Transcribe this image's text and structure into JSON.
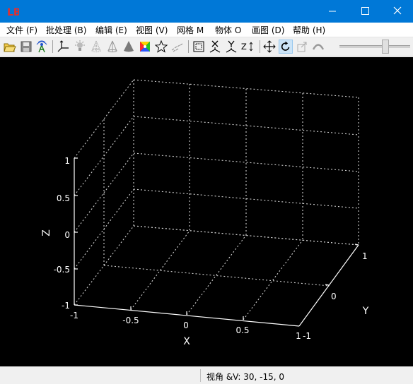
{
  "window": {
    "app_icon_text": "LB"
  },
  "menu": [
    {
      "label": "文件 (F)"
    },
    {
      "label": "批处理 (B)"
    },
    {
      "label": "编辑 (E)"
    },
    {
      "label": "视图 (V)"
    },
    {
      "label": "网格 M"
    },
    {
      "label": "物体 O"
    },
    {
      "label": "画图 (D)"
    },
    {
      "label": "帮助 (H)"
    }
  ],
  "toolbar": {
    "tools": [
      "open-icon",
      "save-icon",
      "antenna-icon",
      "axes-icon",
      "light-icon",
      "cone-wire-icon",
      "cone-mesh-icon",
      "cone-solid-icon",
      "color-cube-icon",
      "star-icon",
      "points-icon",
      "box-frame-icon",
      "view-x-icon",
      "view-y-icon",
      "view-z-icon",
      "move-icon",
      "rotate-icon",
      "export-icon",
      "arc-icon"
    ],
    "active_tool": "rotate-icon",
    "view_z_label": "Z",
    "slider_level": 0.65
  },
  "plot": {
    "z_ticks": [
      "1",
      "0.5",
      "0",
      "-0.5",
      "-1"
    ],
    "x_ticks": [
      "-1",
      "-0.5",
      "0",
      "0.5",
      "1"
    ],
    "y_ticks": [
      "-1",
      "0",
      "1"
    ],
    "x_label": "X",
    "y_label": "Y",
    "z_label": "Z",
    "colors": {
      "background": "#000000",
      "axis": "#ffffff",
      "grid": "#cfcfcf"
    }
  },
  "status": {
    "text": "视角 &V: 30, -15, 0"
  }
}
